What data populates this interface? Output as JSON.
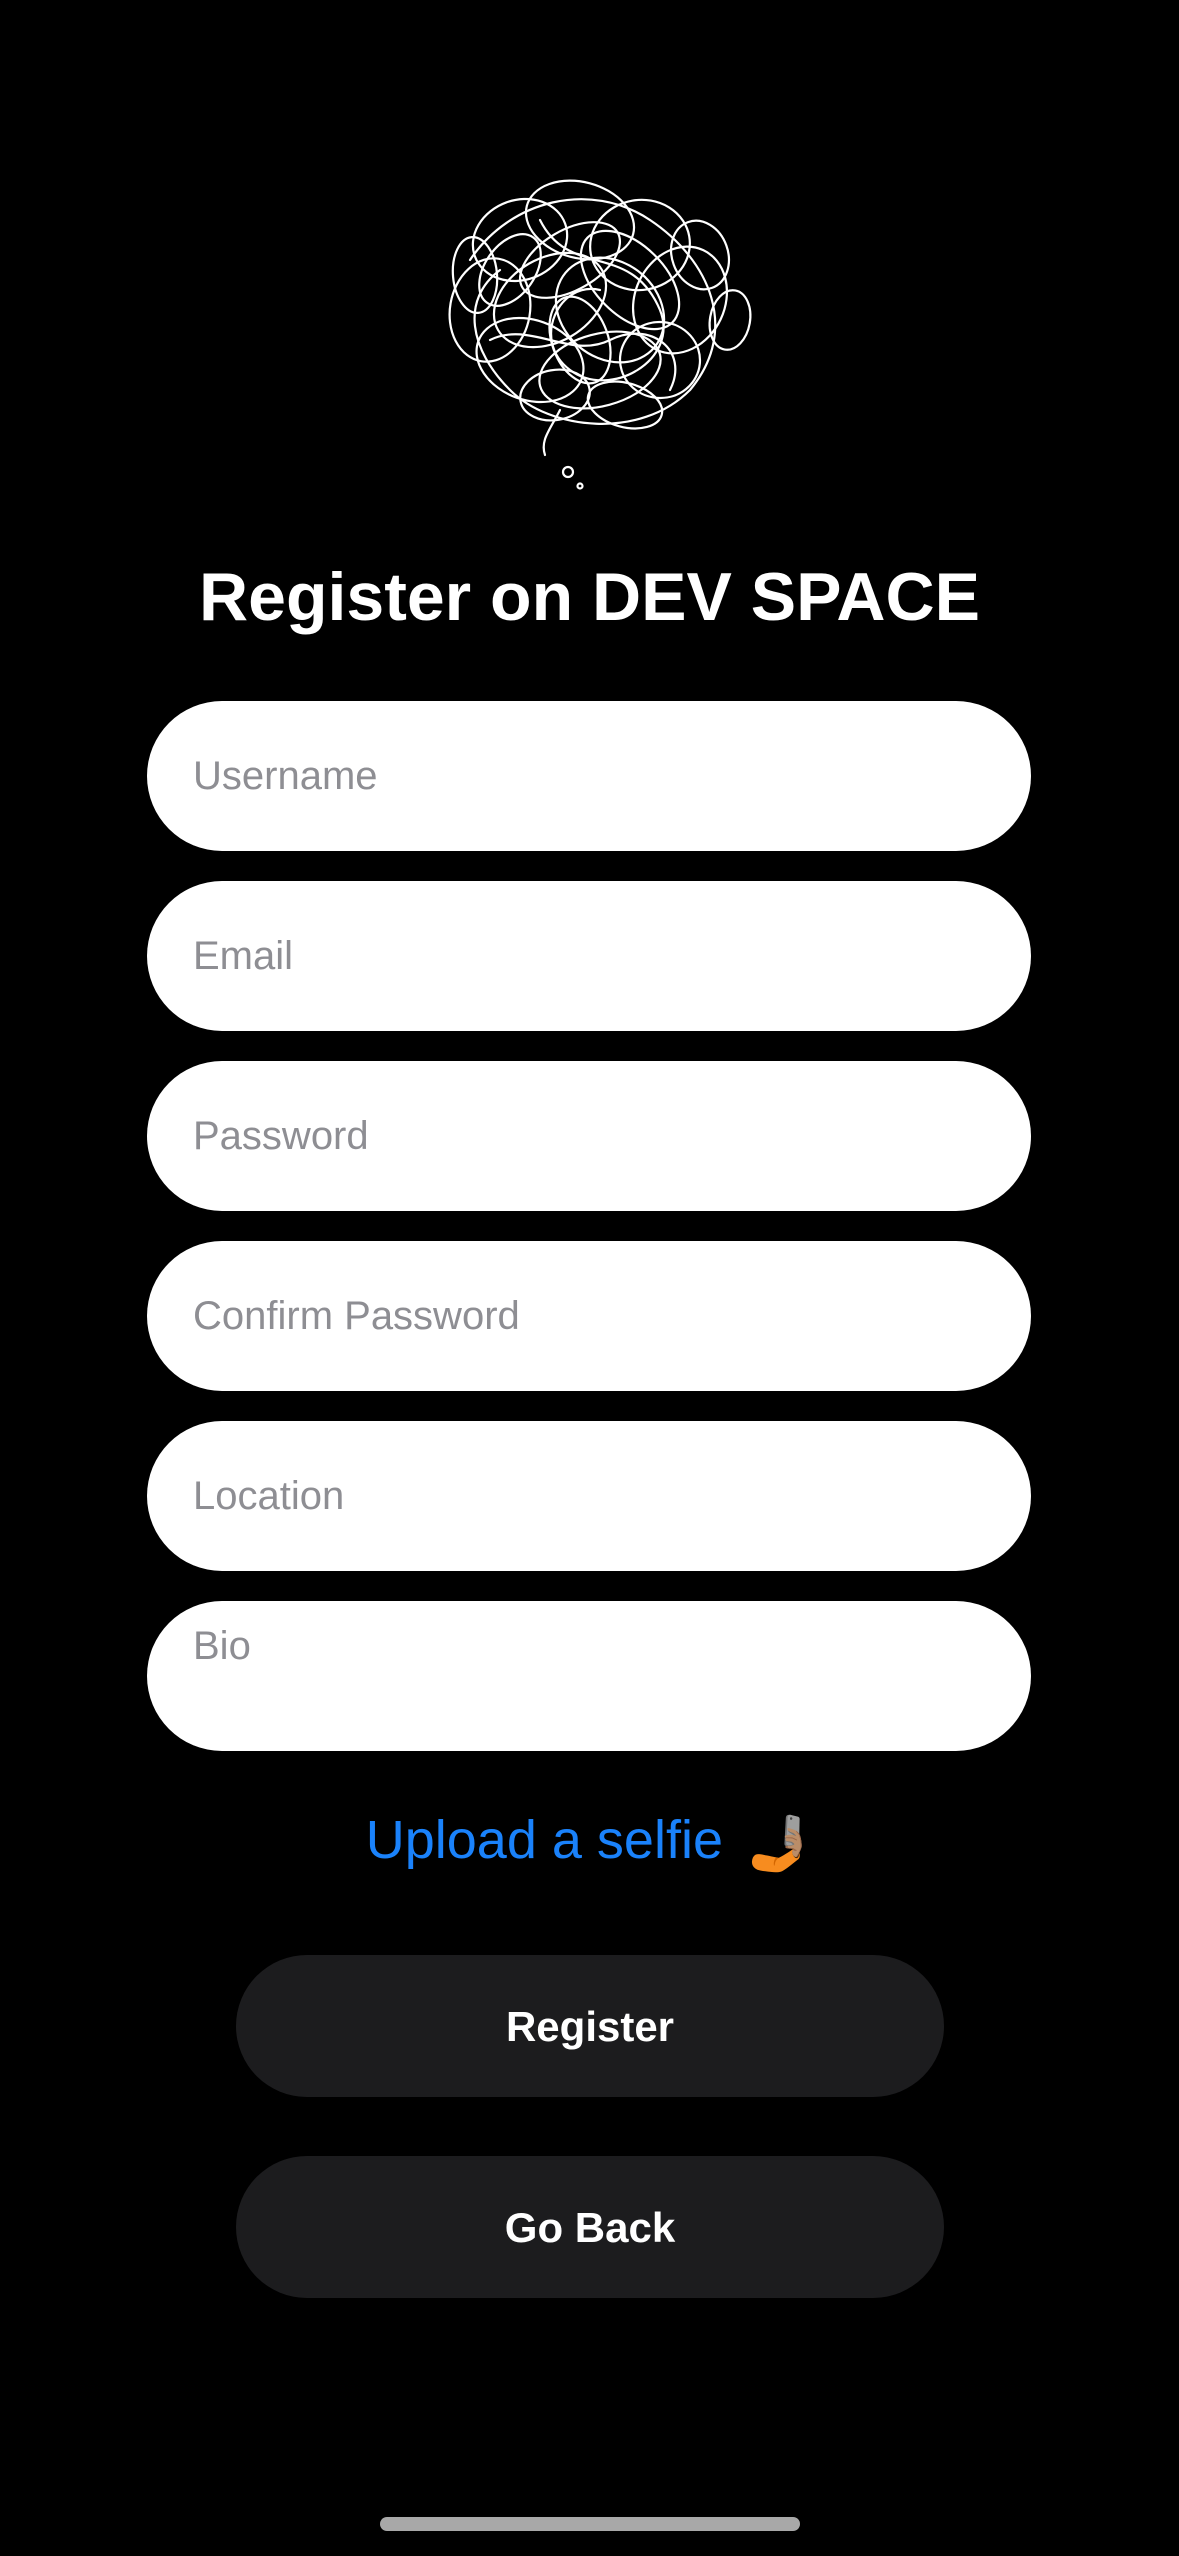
{
  "app": {
    "title": "Register on DEV SPACE",
    "logo_icon": "scribble-thought-cloud-icon"
  },
  "form": {
    "username_placeholder": "Username",
    "email_placeholder": "Email",
    "password_placeholder": "Password",
    "confirm_password_placeholder": "Confirm Password",
    "location_placeholder": "Location",
    "bio_placeholder": "Bio",
    "upload_label": "Upload a selfie",
    "upload_emoji": "🤳🏽"
  },
  "buttons": {
    "register_label": "Register",
    "go_back_label": "Go Back"
  },
  "colors": {
    "background": "#000000",
    "field_background": "#ffffff",
    "placeholder": "#8e8e93",
    "link": "#1a82fb",
    "button_background": "#1c1c1e"
  }
}
